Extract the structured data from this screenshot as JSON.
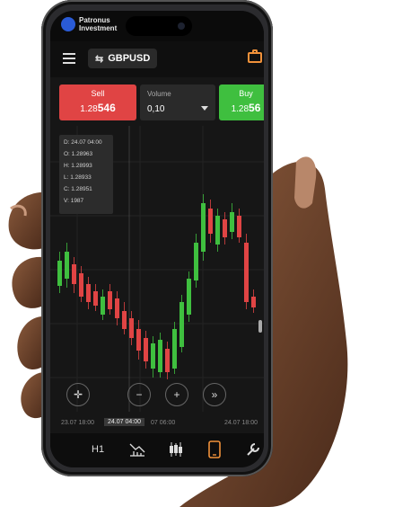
{
  "brand": {
    "name": "Patronus Investment"
  },
  "toolbar": {
    "symbol": "GBPUSD"
  },
  "trade": {
    "sell_label": "Sell",
    "sell_price_prefix": "1.28",
    "sell_price_main": "546",
    "volume_label": "Volume",
    "volume_value": "0,10",
    "buy_label": "Buy",
    "buy_price_prefix": "1.28",
    "buy_price_main": "56"
  },
  "ohlc": {
    "date": "D: 24.07 04:00",
    "open": "O: 1.28963",
    "high": "H: 1.28993",
    "low": "L: 1.28933",
    "close": "C: 1.28951",
    "volume": "V: 1987"
  },
  "controls": {
    "zoom_out": "−",
    "zoom_in": "+",
    "forward": "»"
  },
  "time_axis": {
    "labels": [
      "23.07 18:00",
      "24.07 04:00",
      "07 06:00",
      "24.07 18:00"
    ]
  },
  "bottom_bar": {
    "timeframe": "H1"
  },
  "colors": {
    "sell": "#e04444",
    "buy": "#3fbf3f",
    "accent": "#f0913a",
    "bg": "#161616"
  }
}
